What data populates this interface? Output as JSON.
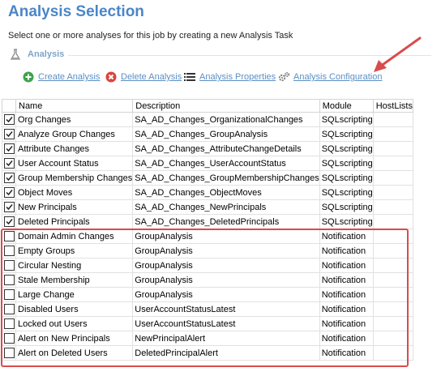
{
  "header": {
    "title": "Analysis Selection",
    "subtitle": "Select one or more analyses for this job by creating a new Analysis Task"
  },
  "section": {
    "label": "Analysis"
  },
  "toolbar": {
    "create": "Create Analysis",
    "delete": "Delete Analysis",
    "properties": "Analysis Properties",
    "configuration": "Analysis Configuration"
  },
  "columns": {
    "name": "Name",
    "description": "Description",
    "module": "Module",
    "hostlists": "HostLists"
  },
  "rows": [
    {
      "checked": true,
      "name": "Org Changes",
      "description": "SA_AD_Changes_OrganizationalChanges",
      "module": "SQLscripting",
      "hostlists": ""
    },
    {
      "checked": true,
      "name": "Analyze Group Changes",
      "description": "SA_AD_Changes_GroupAnalysis",
      "module": "SQLscripting",
      "hostlists": ""
    },
    {
      "checked": true,
      "name": "Attribute Changes",
      "description": "SA_AD_Changes_AttributeChangeDetails",
      "module": "SQLscripting",
      "hostlists": ""
    },
    {
      "checked": true,
      "name": "User Account Status",
      "description": "SA_AD_Changes_UserAccountStatus",
      "module": "SQLscripting",
      "hostlists": ""
    },
    {
      "checked": true,
      "name": "Group Membership Changes",
      "description": "SA_AD_Changes_GroupMembershipChanges",
      "module": "SQLscripting",
      "hostlists": ""
    },
    {
      "checked": true,
      "name": "Object Moves",
      "description": "SA_AD_Changes_ObjectMoves",
      "module": "SQLscripting",
      "hostlists": ""
    },
    {
      "checked": true,
      "name": "New Principals",
      "description": "SA_AD_Changes_NewPrincipals",
      "module": "SQLscripting",
      "hostlists": ""
    },
    {
      "checked": true,
      "name": "Deleted Principals",
      "description": "SA_AD_Changes_DeletedPrincipals",
      "module": "SQLscripting",
      "hostlists": ""
    },
    {
      "checked": false,
      "name": "Domain Admin Changes",
      "description": "GroupAnalysis",
      "module": "Notification",
      "hostlists": ""
    },
    {
      "checked": false,
      "name": "Empty Groups",
      "description": "GroupAnalysis",
      "module": "Notification",
      "hostlists": ""
    },
    {
      "checked": false,
      "name": "Circular Nesting",
      "description": "GroupAnalysis",
      "module": "Notification",
      "hostlists": ""
    },
    {
      "checked": false,
      "name": "Stale Membership",
      "description": "GroupAnalysis",
      "module": "Notification",
      "hostlists": ""
    },
    {
      "checked": false,
      "name": "Large Change",
      "description": "GroupAnalysis",
      "module": "Notification",
      "hostlists": ""
    },
    {
      "checked": false,
      "name": "Disabled Users",
      "description": "UserAccountStatusLatest",
      "module": "Notification",
      "hostlists": ""
    },
    {
      "checked": false,
      "name": "Locked out Users",
      "description": "UserAccountStatusLatest",
      "module": "Notification",
      "hostlists": ""
    },
    {
      "checked": false,
      "name": "Alert on New Principals",
      "description": "NewPrincipalAlert",
      "module": "Notification",
      "hostlists": ""
    },
    {
      "checked": false,
      "name": "Alert on Deleted Users",
      "description": "DeletedPrincipalAlert",
      "module": "Notification",
      "hostlists": ""
    }
  ],
  "colors": {
    "title": "#4a86c8",
    "link": "#5c8fc4",
    "annotation": "#d94c4c",
    "create": "#3fa34d",
    "delete": "#d9453d"
  },
  "icons": {
    "create": "plus-circle-icon",
    "delete": "x-circle-icon",
    "properties": "list-icon",
    "configuration": "gears-icon",
    "section": "flask-icon"
  }
}
